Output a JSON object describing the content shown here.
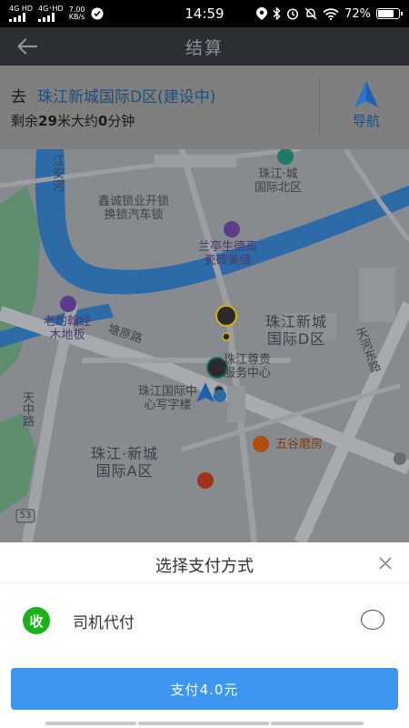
{
  "status_bar": {
    "net1": "4G HD",
    "net2": "4G⁺HD",
    "speed_value": "7.00",
    "speed_unit": "KB/s",
    "time": "14:59",
    "battery": "72%",
    "battery_level": 0.72
  },
  "header": {
    "title": "结算"
  },
  "destination": {
    "prefix": "去",
    "name": "珠江新城国际D区(建设中)",
    "remain_pre": "剩余",
    "distance": "29",
    "remain_mid": "米大约",
    "minutes": "0",
    "remain_post": "分钟",
    "nav_label": "导航"
  },
  "map": {
    "labels": {
      "jiang": "江",
      "an": "安",
      "he": "河",
      "lock_shop": "鑫诚锁业开锁\n换锁汽车锁",
      "beauty": "兰亭生德高\n瓷砖美缝",
      "north": "珠江·城\n国际北区",
      "d_zone": "珠江新城\n国际D区",
      "laoyue": "老约翰经\n木地板",
      "road1": "塘原路",
      "road2": "天河东路",
      "road3": "天中路",
      "zunshi": "珠江尊贵\n服务中心",
      "school": "珠江国际中\n心写字楼",
      "wugu": "五谷磨房",
      "a_zone": "珠江·新城\n国际A区",
      "route": "53"
    }
  },
  "payment": {
    "title": "选择支付方式",
    "option_icon": "收",
    "option_label": "司机代付",
    "pay_button": "支付4.0元"
  },
  "colors": {
    "accent": "#3d97f0",
    "option_green": "#19b319",
    "river": "#2c6aa8",
    "nav_arrow": "#1f5fb0"
  }
}
